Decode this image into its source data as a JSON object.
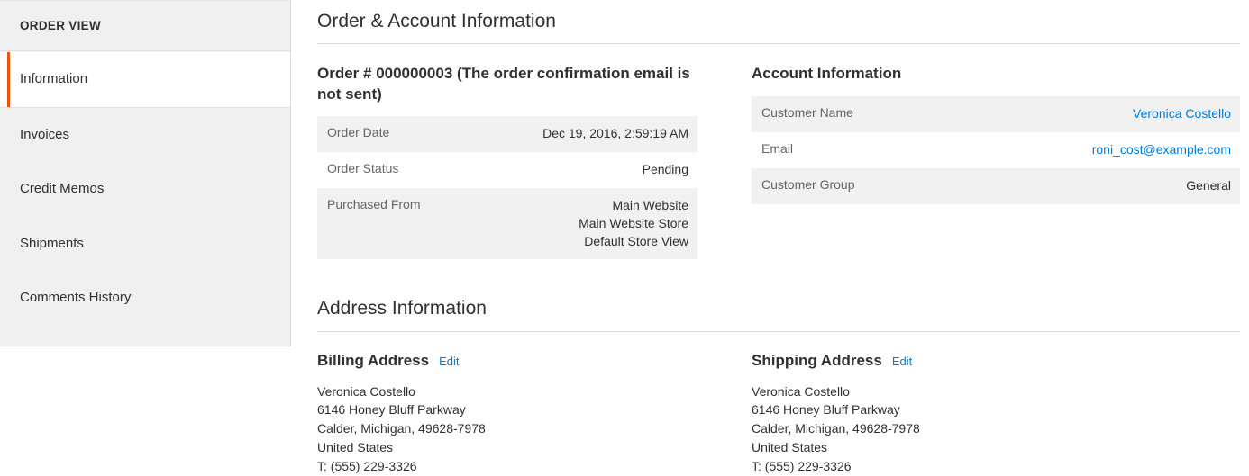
{
  "sidebar": {
    "title": "ORDER VIEW",
    "items": [
      {
        "label": "Information",
        "active": true
      },
      {
        "label": "Invoices",
        "active": false
      },
      {
        "label": "Credit Memos",
        "active": false
      },
      {
        "label": "Shipments",
        "active": false
      },
      {
        "label": "Comments History",
        "active": false
      }
    ]
  },
  "order_account_section": {
    "heading": "Order & Account Information",
    "order": {
      "title": "Order # 000000003 (The order confirmation email is not sent)",
      "rows": [
        {
          "label": "Order Date",
          "value": "Dec 19, 2016, 2:59:19 AM"
        },
        {
          "label": "Order Status",
          "value": "Pending"
        }
      ],
      "purchased_from_label": "Purchased From",
      "purchased_from_lines": [
        "Main Website",
        "Main Website Store",
        "Default Store View"
      ]
    },
    "account": {
      "title": "Account Information",
      "customer_name_label": "Customer Name",
      "customer_name_value": "Veronica Costello",
      "email_label": "Email",
      "email_value": "roni_cost@example.com",
      "customer_group_label": "Customer Group",
      "customer_group_value": "General"
    }
  },
  "address_section": {
    "heading": "Address Information",
    "billing": {
      "title": "Billing Address",
      "edit_label": "Edit",
      "lines": [
        "Veronica Costello",
        "6146 Honey Bluff Parkway",
        "Calder, Michigan, 49628-7978",
        "United States",
        "T: (555) 229-3326"
      ]
    },
    "shipping": {
      "title": "Shipping Address",
      "edit_label": "Edit",
      "lines": [
        "Veronica Costello",
        "6146 Honey Bluff Parkway",
        "Calder, Michigan, 49628-7978",
        "United States",
        "T: (555) 229-3326"
      ]
    }
  },
  "colors": {
    "accent_orange": "#eb5202",
    "link_blue": "#007bdb",
    "text_dark": "#303030",
    "label_gray": "#666666",
    "stripe_gray": "#f1f1f1",
    "sidebar_bg": "#f0f0f0"
  }
}
